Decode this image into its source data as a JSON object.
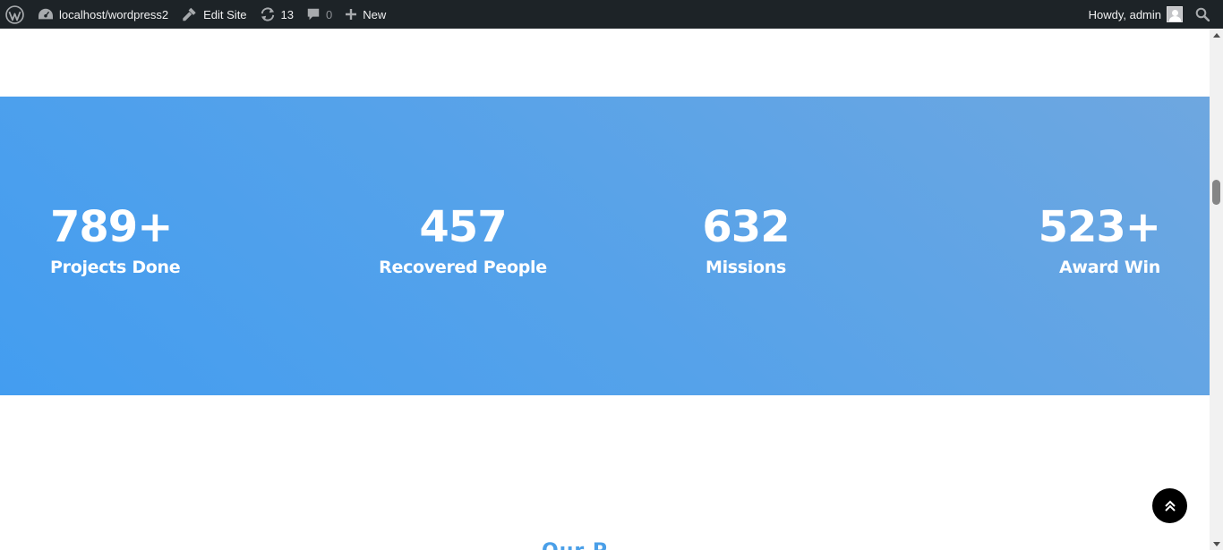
{
  "admin_bar": {
    "wp_logo_icon": "wordpress-logo-icon",
    "site": {
      "icon": "dashboard-icon",
      "label": "localhost/wordpress2"
    },
    "edit_site": {
      "icon": "brush-icon",
      "label": "Edit Site"
    },
    "updates": {
      "icon": "updates-icon",
      "count": "13"
    },
    "comments": {
      "icon": "comment-icon",
      "count": "0"
    },
    "new": {
      "icon": "plus-icon",
      "label": "New"
    },
    "account": {
      "greeting": "Howdy, admin",
      "icon": "avatar"
    },
    "search": {
      "icon": "search-icon"
    }
  },
  "counters": [
    {
      "value": "789+",
      "caption": "Projects Done"
    },
    {
      "value": "457",
      "caption": "Recovered People"
    },
    {
      "value": "632",
      "caption": "Missions"
    },
    {
      "value": "523+",
      "caption": "Award Win"
    }
  ],
  "next_section": {
    "heading_partial": "Our P"
  },
  "back_to_top": {
    "icon": "double-chevron-up-icon"
  },
  "colors": {
    "admin_bar_bg": "#1d2327",
    "band_start": "#439df0",
    "band_end": "#6ea7e0",
    "accent": "#4a9fe8"
  }
}
